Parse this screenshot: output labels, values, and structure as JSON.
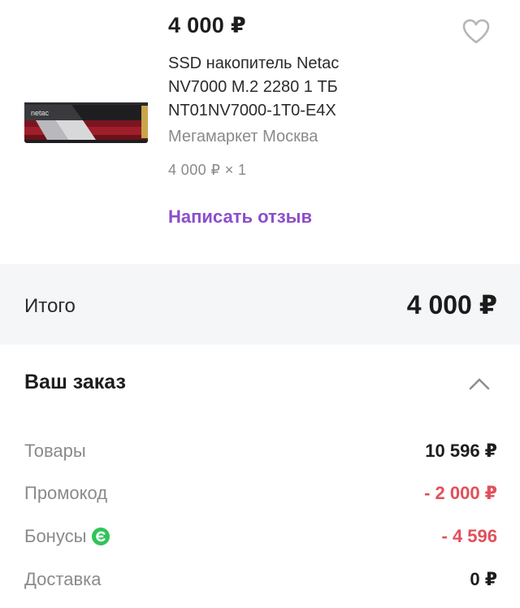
{
  "product": {
    "price": "4 000 ₽",
    "title": "SSD накопитель Netac NV7000 M.2 2280 1 ТБ NT01NV7000-1T0-E4X",
    "seller": "Мегамаркет Москва",
    "quantity": "4 000 ₽ × 1",
    "review_link": "Написать отзыв",
    "favorite_icon": "heart-outline-icon",
    "thumbnail_brand": "netac"
  },
  "total": {
    "label": "Итого",
    "value": "4 000 ₽"
  },
  "order": {
    "title": "Ваш заказ",
    "toggle_icon": "chevron-up-icon",
    "rows": [
      {
        "label": "Товары",
        "value": "10 596 ₽"
      },
      {
        "label": "Промокод",
        "value": "- 2 000 ₽"
      },
      {
        "label": "Бонусы",
        "value": "- 4 596",
        "icon": "bonus-icon"
      },
      {
        "label": "Доставка",
        "value": "0 ₽"
      }
    ]
  },
  "colors": {
    "accent_purple": "#8c4ecb",
    "discount_red": "#e2505a",
    "bonus_green": "#2ec458",
    "muted_text": "#8a8a8a",
    "total_background": "#f5f6f8"
  }
}
